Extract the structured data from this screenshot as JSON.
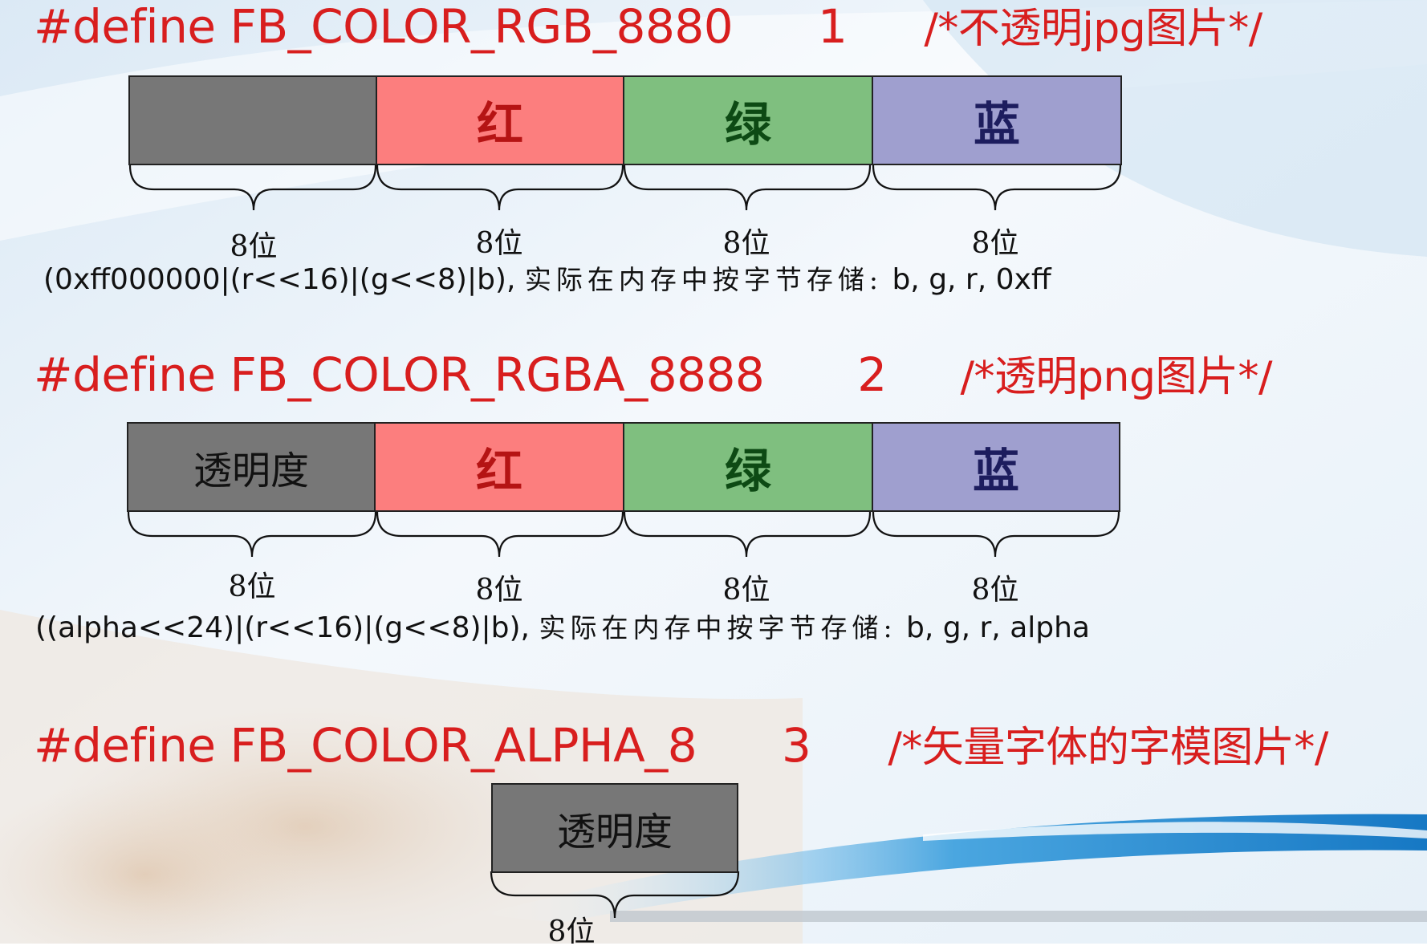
{
  "rgb8880": {
    "define": "#define FB_COLOR_RGB_8880",
    "value": "1",
    "comment": "/*不透明jpg图片*/",
    "cells": [
      "",
      "红",
      "绿",
      "蓝"
    ],
    "bits": [
      "8位",
      "8位",
      "8位",
      "8位"
    ],
    "formula_code": "(0xff000000|(r<<16)|(g<<8)|b),",
    "formula_text": "实际在内存中按字节存储:",
    "formula_order": "b, g, r, 0xff"
  },
  "rgba8888": {
    "define": "#define FB_COLOR_RGBA_8888",
    "value": "2",
    "comment": "/*透明png图片*/",
    "cells": [
      "透明度",
      "红",
      "绿",
      "蓝"
    ],
    "bits": [
      "8位",
      "8位",
      "8位",
      "8位"
    ],
    "formula_code": "((alpha<<24)|(r<<16)|(g<<8)|b),",
    "formula_text": "实际在内存中按字节存储:",
    "formula_order": "b, g, r, alpha"
  },
  "alpha8": {
    "define": "#define FB_COLOR_ALPHA_8",
    "value": "3",
    "comment": "/*矢量字体的字模图片*/",
    "cells": [
      "透明度"
    ],
    "bits": [
      "8位"
    ]
  },
  "colors": {
    "define_red": "#d81e1e",
    "alpha_gray": "#777777",
    "red": "#fc7e7e",
    "green": "#7fbf7f",
    "blue": "#9f9fcf"
  }
}
